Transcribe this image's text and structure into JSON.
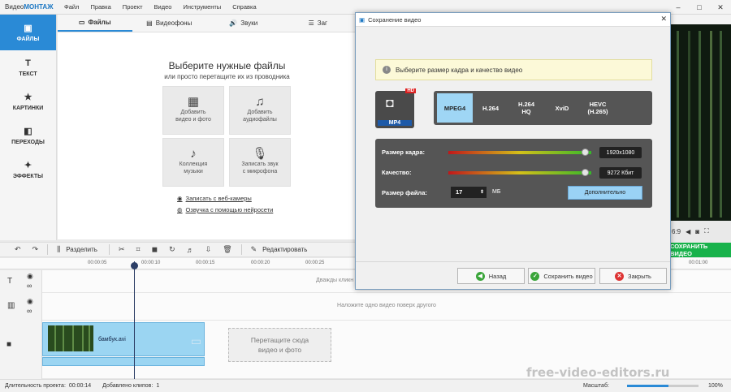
{
  "app": {
    "name_prefix": "Видео",
    "name_brand": "МОНТАЖ",
    "menu": [
      "Файл",
      "Правка",
      "Проект",
      "Видео",
      "Инструменты",
      "Справка"
    ],
    "window_controls": [
      "–",
      "□",
      "✕"
    ]
  },
  "sidebar": {
    "items": [
      {
        "label": "ФАЙЛЫ",
        "icon": "folder-icon",
        "glyph": "▣",
        "active": true
      },
      {
        "label": "ТЕКСТ",
        "icon": "text-icon",
        "glyph": "T",
        "active": false
      },
      {
        "label": "КАРТИНКИ",
        "icon": "star-icon",
        "glyph": "★",
        "active": false
      },
      {
        "label": "ПЕРЕХОДЫ",
        "icon": "transitions-icon",
        "glyph": "◧",
        "active": false
      },
      {
        "label": "ЭФФЕКТЫ",
        "icon": "magic-wand-icon",
        "glyph": "✦",
        "active": false
      }
    ]
  },
  "tabs": [
    {
      "label": "Файлы",
      "glyph": "▭",
      "active": true
    },
    {
      "label": "Видеофоны",
      "glyph": "▤",
      "active": false
    },
    {
      "label": "Звуки",
      "glyph": "🔊",
      "active": false
    },
    {
      "label": "Заг",
      "glyph": "☰",
      "active": false
    }
  ],
  "files_panel": {
    "title": "Выберите нужные файлы",
    "subtitle": "или просто перетащите их из проводника",
    "tiles": [
      {
        "line1": "Добавить",
        "line2": "видео и фото",
        "glyph": "▦"
      },
      {
        "line1": "Добавить",
        "line2": "аудиофайлы",
        "glyph": "♫"
      },
      {
        "line1": "Коллекция",
        "line2": "музыки",
        "glyph": "♪"
      },
      {
        "line1": "Записать звук",
        "line2": "с микрофона",
        "glyph": "🎙"
      }
    ],
    "links": [
      "Записать с веб-камеры",
      "Озвучка с помощью нейросети"
    ]
  },
  "preview": {
    "aspect": "6:9",
    "save_button": "СОХРАНИТЬ ВИДЕО"
  },
  "toolbar": {
    "undo": "↶",
    "redo": "↷",
    "split_label": "Разделить",
    "edit_label": "Редактировать"
  },
  "timeline": {
    "ticks": [
      "00:00:05",
      "00:00:10",
      "00:00:15",
      "00:00:20",
      "00:00:25",
      "00:01:00"
    ],
    "text_track_hint": "Дважды кликн",
    "overlay_track_hint": "Наложите одно видео поверх другого",
    "clip_name": "бамбук.avi",
    "drop_zone_line1": "Перетащите сюда",
    "drop_zone_line2": "видео и фото"
  },
  "statusbar": {
    "duration_label": "Длительность проекта:",
    "duration_value": "00:00:14",
    "clips_label": "Добавлено клипов:",
    "clips_value": "1",
    "zoom_label": "Масштаб:",
    "zoom_value": "100%",
    "zoom_fraction": 0.58
  },
  "watermark": "free-video-editors.ru",
  "dialog": {
    "title": "Сохранение видео",
    "notice": "Выберите размер кадра и качество видео",
    "format_badge": "MP4",
    "hd_badge": "HD",
    "codecs": [
      {
        "line1": "MPEG4",
        "line2": "",
        "active": true
      },
      {
        "line1": "H.264",
        "line2": "",
        "active": false
      },
      {
        "line1": "H.264",
        "line2": "HQ",
        "active": false
      },
      {
        "line1": "XviD",
        "line2": "",
        "active": false
      },
      {
        "line1": "HEVC",
        "line2": "(H.265)",
        "active": false
      }
    ],
    "frame_size_label": "Размер кадра:",
    "frame_size_value": "1920x1080",
    "frame_size_level": 0.96,
    "quality_label": "Качество:",
    "quality_value": "9272 Кбит",
    "quality_level": 0.96,
    "file_size_label": "Размер файла:",
    "file_size_value": "17",
    "file_size_unit": "МБ",
    "advanced_button": "Дополнительно",
    "back_button": "Назад",
    "save_button": "Сохранить видео",
    "close_button": "Закрыть"
  },
  "colors": {
    "accent": "#2a8ad6",
    "save_green": "#18b24b",
    "clip_blue": "#9bd5f2"
  }
}
